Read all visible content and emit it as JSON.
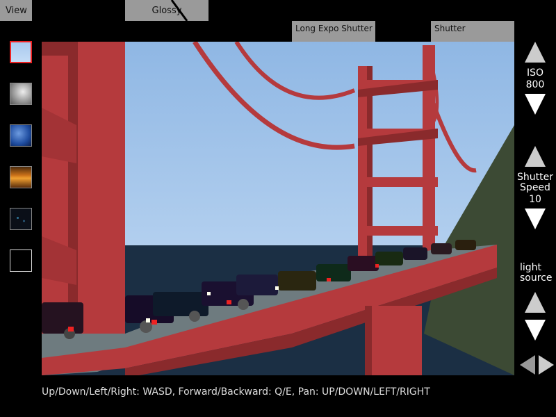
{
  "tabs": {
    "view": "View",
    "glossy": "Glossy",
    "long_expo_shutter": "Long Expo Shutter",
    "shutter": "Shutter"
  },
  "backgrounds": [
    {
      "name": "clear-sky",
      "selected": true
    },
    {
      "name": "cloudy-sky",
      "selected": false
    },
    {
      "name": "blue-sky",
      "selected": false
    },
    {
      "name": "sunset-sky",
      "selected": false
    },
    {
      "name": "night-sky",
      "selected": false
    },
    {
      "name": "black",
      "selected": false
    }
  ],
  "controls": {
    "iso_label": "ISO",
    "iso_value": "800",
    "shutter_label_1": "Shutter",
    "shutter_label_2": "Speed",
    "shutter_value": "10",
    "light_label_1": "light",
    "light_label_2": "source"
  },
  "help_text": "Up/Down/Left/Right: WASD, Forward/Backward: Q/E, Pan: UP/DOWN/LEFT/RIGHT",
  "colors": {
    "bridge_red": "#b53a3d",
    "sky_top": "#8fb7e4",
    "sky_bottom": "#c6ddf4",
    "water": "#1b2f44",
    "hill": "#3c4a34",
    "selection_border": "#e22222"
  }
}
